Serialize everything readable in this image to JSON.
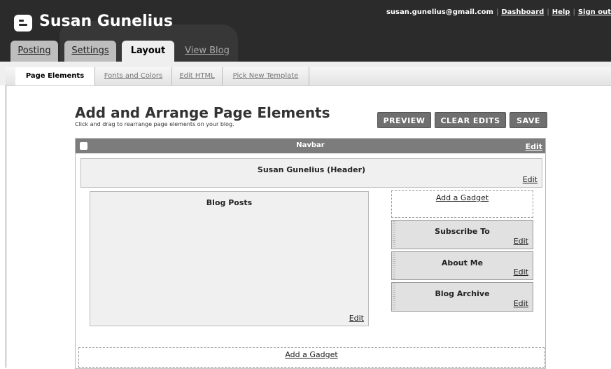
{
  "header": {
    "site_title": "Susan Gunelius",
    "email": "susan.gunelius@gmail.com",
    "links": [
      "Dashboard",
      "Help",
      "Sign out"
    ]
  },
  "tabs": [
    "Posting",
    "Settings",
    "Layout",
    "View Blog"
  ],
  "subtabs": [
    "Page Elements",
    "Fonts and Colors",
    "Edit HTML",
    "Pick New Template"
  ],
  "page": {
    "title": "Add and Arrange Page Elements",
    "description": "Click and drag to rearrange page elements on your blog.",
    "buttons": [
      "PREVIEW",
      "CLEAR EDITS",
      "SAVE"
    ]
  },
  "layout": {
    "navbar": {
      "title": "Navbar",
      "edit": "Edit"
    },
    "header": {
      "title": "Susan Gunelius (Header)",
      "edit": "Edit"
    },
    "blog_posts": {
      "title": "Blog Posts",
      "edit": "Edit"
    },
    "sidebar": {
      "add_gadget": "Add a Gadget",
      "gadgets": [
        {
          "title": "Subscribe To",
          "edit": "Edit"
        },
        {
          "title": "About Me",
          "edit": "Edit"
        },
        {
          "title": "Blog Archive",
          "edit": "Edit"
        }
      ]
    },
    "footer": {
      "add_gadget": "Add a Gadget"
    }
  },
  "colors": {
    "topbar": "#2b2b2b",
    "navbar": "#7c7c7c",
    "button": "#6f6f6f"
  },
  "icons": {
    "logo": "blogger-logo-icon",
    "navbar": "blogger-small-icon"
  }
}
